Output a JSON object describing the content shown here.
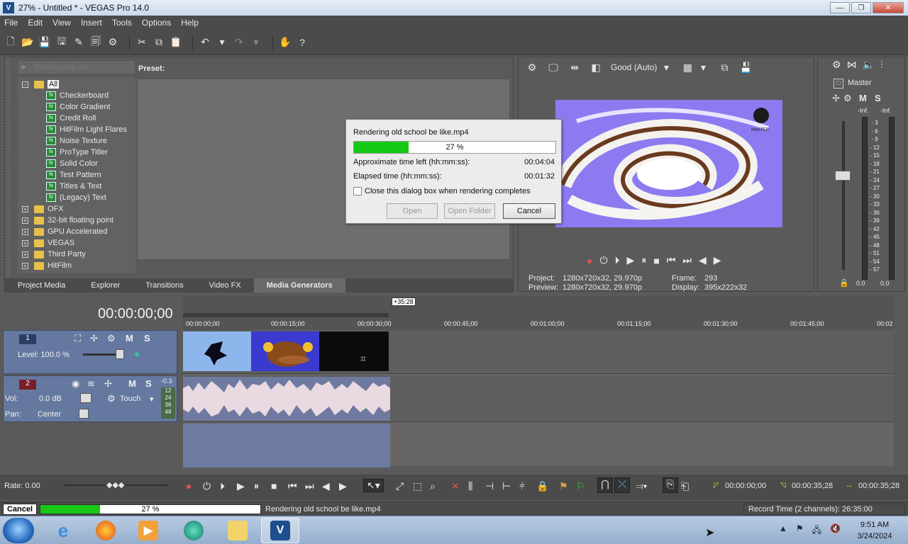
{
  "window": {
    "title": "27% - Untitled * - VEGAS Pro 14.0",
    "app_icon_text": "V"
  },
  "menu": [
    "File",
    "Edit",
    "View",
    "Insert",
    "Tools",
    "Options",
    "Help"
  ],
  "plugins": {
    "search_placeholder": "Search plug-ins",
    "preset_label": "Preset:",
    "tree": [
      {
        "label": "All",
        "level": 0,
        "type": "folder",
        "expanded": true,
        "selected": true
      },
      {
        "label": "Checkerboard",
        "level": 1,
        "type": "fx"
      },
      {
        "label": "Color Gradient",
        "level": 1,
        "type": "fx"
      },
      {
        "label": "Credit Roll",
        "level": 1,
        "type": "fx"
      },
      {
        "label": "HitFilm Light Flares",
        "level": 1,
        "type": "fx"
      },
      {
        "label": "Noise Texture",
        "level": 1,
        "type": "fx"
      },
      {
        "label": "ProType Titler",
        "level": 1,
        "type": "fx"
      },
      {
        "label": "Solid Color",
        "level": 1,
        "type": "fx"
      },
      {
        "label": "Test Pattern",
        "level": 1,
        "type": "fx"
      },
      {
        "label": "Titles & Text",
        "level": 1,
        "type": "fx"
      },
      {
        "label": "(Legacy) Text",
        "level": 1,
        "type": "fx"
      },
      {
        "label": "OFX",
        "level": 0,
        "type": "folder"
      },
      {
        "label": "32-bit floating point",
        "level": 0,
        "type": "folder"
      },
      {
        "label": "GPU Accelerated",
        "level": 0,
        "type": "folder"
      },
      {
        "label": "VEGAS",
        "level": 0,
        "type": "folder"
      },
      {
        "label": "Third Party",
        "level": 0,
        "type": "folder"
      },
      {
        "label": "HitFilm",
        "level": 0,
        "type": "folder"
      }
    ],
    "tabs": [
      "Project Media",
      "Explorer",
      "Transitions",
      "Video FX",
      "Media Generators"
    ],
    "active_tab": "Media Generators"
  },
  "preview": {
    "quality": "Good (Auto)",
    "project_label": "Project:",
    "project_value": "1280x720x32, 29.970p",
    "preview_label": "Preview:",
    "preview_value": "1280x720x32, 29.970p",
    "frame_label": "Frame:",
    "frame_value": "293",
    "display_label": "Display:",
    "display_value": "395x222x32",
    "watermark": "MASTER"
  },
  "master": {
    "label": "Master",
    "m": "M",
    "s": "S",
    "inf_left": "-Inf.",
    "inf_right": "-Inf.",
    "scale": [
      "3",
      "6",
      "9",
      "12",
      "15",
      "18",
      "21",
      "24",
      "27",
      "30",
      "33",
      "36",
      "39",
      "42",
      "45",
      "48",
      "51",
      "54",
      "57"
    ],
    "val_left": "0.0",
    "val_right": "0.0"
  },
  "timeline": {
    "timecode": "00:00:00;00",
    "marker": "+35:28",
    "ticks": [
      "00:00:00;00",
      "00:00:15;00",
      "00:00:30;00",
      "00:00:45;00",
      "00:01:00;00",
      "00:01:15;00",
      "00:01:30;00",
      "00:01:45;00",
      "00:02"
    ],
    "video_track": {
      "number": "1",
      "level_label": "Level: 100.0 %",
      "m": "M",
      "s": "S"
    },
    "audio_track": {
      "number": "2",
      "vol_label": "Vol:",
      "vol_value": "0.0 dB",
      "pan_label": "Pan:",
      "pan_value": "Center",
      "mode": "Touch",
      "m": "M",
      "s": "S",
      "peak": "-0.3",
      "meter_ticks": [
        "12",
        "24",
        "36",
        "48"
      ]
    },
    "rate_label": "Rate: 0.00",
    "sel_start": "00:00:00;00",
    "sel_end": "00:00:35;28",
    "sel_length": "00:00:35;28"
  },
  "render_dialog": {
    "title": "Rendering old school be like.mp4",
    "progress_text": "27 %",
    "progress": 0.27,
    "time_left_label": "Approximate time left (hh:mm:ss):",
    "time_left_value": "00:04:04",
    "elapsed_label": "Elapsed time (hh:mm:ss):",
    "elapsed_value": "00:01:32",
    "checkbox_label": "Close this dialog box when rendering completes",
    "btn_open": "Open",
    "btn_open_folder": "Open Folder",
    "btn_cancel": "Cancel"
  },
  "status": {
    "cancel": "Cancel",
    "progress_text": "27 %",
    "progress": 0.27,
    "text": "Rendering old school be like.mp4",
    "record_time": "Record Time (2 channels): 26:35:00"
  },
  "taskbar": {
    "time": "9:51 AM",
    "date": "3/24/2024"
  }
}
